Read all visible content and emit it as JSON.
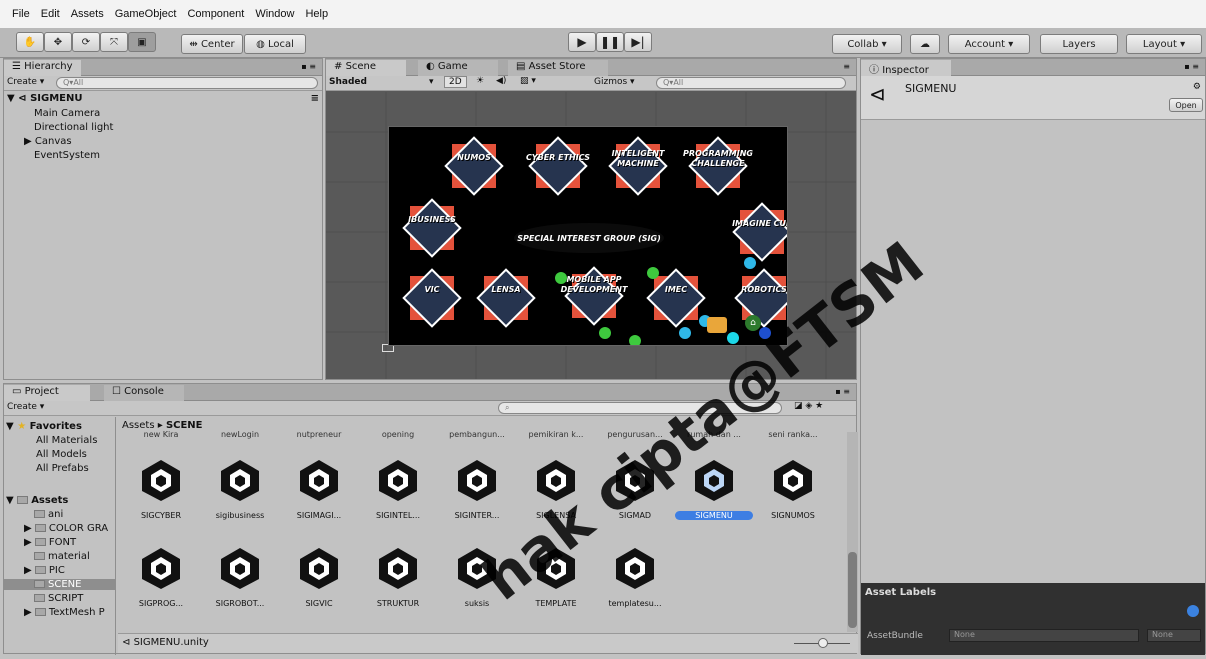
{
  "menu": [
    "File",
    "Edit",
    "Assets",
    "GameObject",
    "Component",
    "Window",
    "Help"
  ],
  "toolbar": {
    "pivot_label": "Center",
    "space_label": "Local",
    "collab_label": "Collab ▾",
    "account_label": "Account ▾",
    "layers_label": "Layers",
    "layout_label": "Layout ▾"
  },
  "hierarchy": {
    "tab": "Hierarchy",
    "create": "Create ▾",
    "search_placeholder": "Q▾All",
    "scene_name": "SIGMENU",
    "items": [
      "Main Camera",
      "Directional light",
      "Canvas",
      "EventSystem"
    ]
  },
  "scene": {
    "tabs": [
      "Scene",
      "Game",
      "Asset Store"
    ],
    "shading": "Shaded",
    "mode_2d": "2D",
    "gizmos": "Gizmos ▾",
    "search_placeholder": "Q▾All",
    "center_title": "SPECIAL INTEREST GROUP (SIG)",
    "buttons": [
      "NUMOS",
      "CYBER ETHICS",
      "INTELIGENT MACHINE",
      "PROGRAMMING CHALLENGE",
      "IBUSINESS",
      "IMAGINE CUP",
      "VIC",
      "LENSA",
      "MOBILE APP DEVELOPMENT",
      "IMEC",
      "ROBOTICS"
    ]
  },
  "inspector": {
    "tab": "Inspector",
    "object_name": "SIGMENU",
    "open_label": "Open",
    "asset_labels": "Asset Labels",
    "asset_bundle_label": "AssetBundle",
    "asset_bundle_value": "None",
    "asset_variant_value": "None"
  },
  "project": {
    "tabs": [
      "Project",
      "Console"
    ],
    "create": "Create ▾",
    "breadcrumb_root": "Assets",
    "breadcrumb_leaf": "SCENE",
    "favorites_title": "Favorites",
    "favorites": [
      "All Materials",
      "All Models",
      "All Prefabs"
    ],
    "assets_title": "Assets",
    "folders": [
      "ani",
      "COLOR GRA",
      "FONT",
      "material",
      "PIC",
      "SCENE",
      "SCRIPT",
      "TextMesh P"
    ],
    "top_row": [
      "new Kira",
      "newLogin",
      "nutpreneur",
      "opening",
      "pembangun...",
      "pemikiran k...",
      "pengurusan...",
      "rumah dan ...",
      "seni ranka..."
    ],
    "row1": [
      "SIGCYBER",
      "sigibusiness",
      "SIGIMAGI...",
      "SIGINTEL...",
      "SIGINTER...",
      "SIGLENSA",
      "SIGMAD",
      "SIGMENU",
      "SIGNUMOS"
    ],
    "row2": [
      "SIGPROG...",
      "SIGROBOT...",
      "SIGVIC",
      "STRUKTUR",
      "suksis",
      "TEMPLATE",
      "templatesu..."
    ],
    "status_file": "SIGMENU.unity"
  },
  "watermark": "hak cipta@FTSM"
}
